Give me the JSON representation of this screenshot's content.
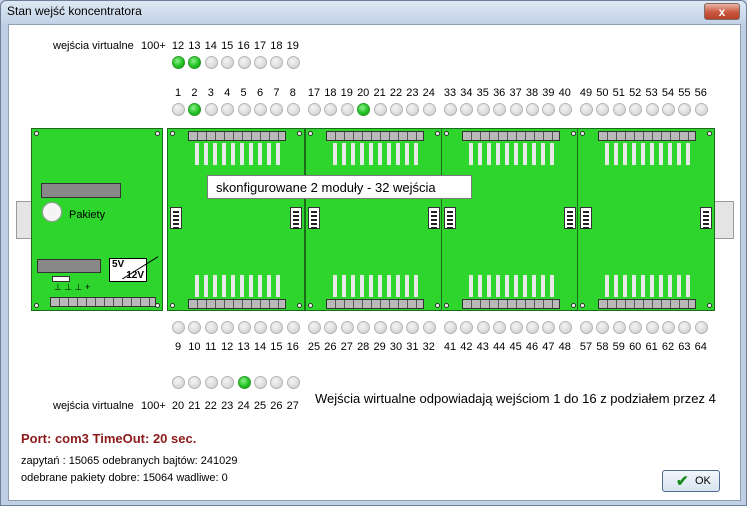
{
  "window": {
    "title": "Stan wejść koncentratora",
    "close_label": "x"
  },
  "virtual_top": {
    "label": "wejścia virtualne",
    "suffix": "100+",
    "numbers": [
      "12",
      "13",
      "14",
      "15",
      "16",
      "17",
      "18",
      "19"
    ],
    "states": [
      true,
      true,
      false,
      false,
      false,
      false,
      false,
      false
    ]
  },
  "virtual_bottom": {
    "label": "wejścia virtualne",
    "suffix": "100+",
    "numbers": [
      "20",
      "21",
      "22",
      "23",
      "24",
      "25",
      "26",
      "27"
    ],
    "states": [
      false,
      false,
      false,
      false,
      true,
      false,
      false,
      false
    ]
  },
  "top_inputs": [
    {
      "numbers": [
        "1",
        "2",
        "3",
        "4",
        "5",
        "6",
        "7",
        "8"
      ],
      "states": [
        false,
        true,
        false,
        false,
        false,
        false,
        false,
        false
      ]
    },
    {
      "numbers": [
        "17",
        "18",
        "19",
        "20",
        "21",
        "22",
        "23",
        "24"
      ],
      "states": [
        false,
        false,
        false,
        true,
        false,
        false,
        false,
        false
      ]
    },
    {
      "numbers": [
        "33",
        "34",
        "35",
        "36",
        "37",
        "38",
        "39",
        "40"
      ],
      "states": [
        false,
        false,
        false,
        false,
        false,
        false,
        false,
        false
      ]
    },
    {
      "numbers": [
        "49",
        "50",
        "51",
        "52",
        "53",
        "54",
        "55",
        "56"
      ],
      "states": [
        false,
        false,
        false,
        false,
        false,
        false,
        false,
        false
      ]
    }
  ],
  "bottom_inputs": [
    {
      "numbers": [
        "9",
        "10",
        "11",
        "12",
        "13",
        "14",
        "15",
        "16"
      ],
      "states": [
        false,
        false,
        false,
        false,
        false,
        false,
        false,
        false
      ]
    },
    {
      "numbers": [
        "25",
        "26",
        "27",
        "28",
        "29",
        "30",
        "31",
        "32"
      ],
      "states": [
        false,
        false,
        false,
        false,
        false,
        false,
        false,
        false
      ]
    },
    {
      "numbers": [
        "41",
        "42",
        "43",
        "44",
        "45",
        "46",
        "47",
        "48"
      ],
      "states": [
        false,
        false,
        false,
        false,
        false,
        false,
        false,
        false
      ]
    },
    {
      "numbers": [
        "57",
        "58",
        "59",
        "60",
        "61",
        "62",
        "63",
        "64"
      ],
      "states": [
        false,
        false,
        false,
        false,
        false,
        false,
        false,
        false
      ]
    }
  ],
  "board": {
    "status": "skonfigurowane 2 moduły - 32 wejścia",
    "packets_label": "Pakiety",
    "voltage_5v": "5V",
    "voltage_12v": "12V",
    "term_marks": "⊥ ⊥ ⊥ +"
  },
  "virtual_note": "Wejścia wirtualne odpowiadają wejściom 1 do 16 z podziałem przez 4",
  "port_line": "Port: com3  TimeOut: 20 sec.",
  "stats": {
    "line1": "zapytań : 15065   odebranych bajtów: 241029",
    "line2": "odebrane pakiety dobre: 15064 wadliwe: 0"
  },
  "ok_label": "OK",
  "colors": {
    "led_on": "#22c322",
    "board": "#2dd52d",
    "port_text": "#8b1a1a"
  }
}
